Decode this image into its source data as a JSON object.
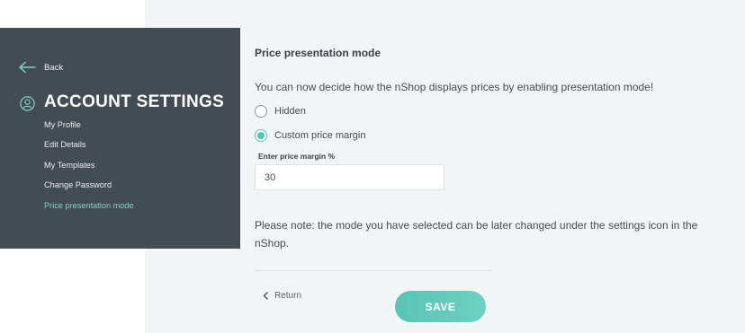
{
  "sidebar": {
    "back_label": "Back",
    "title": "ACCOUNT SETTINGS",
    "items": [
      {
        "label": "My Profile",
        "active": false
      },
      {
        "label": "Edit Details",
        "active": false
      },
      {
        "label": "My Templates",
        "active": false
      },
      {
        "label": "Change Password",
        "active": false
      },
      {
        "label": "Price presentation mode",
        "active": true
      }
    ]
  },
  "main": {
    "section_title": "Price presentation mode",
    "intro": "You can now decide how the nShop displays prices by enabling presentation mode!",
    "options": [
      {
        "label": "Hidden",
        "selected": false
      },
      {
        "label": "Custom price margin",
        "selected": true
      }
    ],
    "margin_field": {
      "label": "Enter price margin %",
      "value": "30"
    },
    "note": "Please note: the mode you have selected can be later changed under the settings icon in the nShop.",
    "return_label": "Return",
    "save_label": "SAVE"
  },
  "icons": {
    "back": "arrow-left-icon",
    "account": "user-icon",
    "return": "chevron-left-icon"
  },
  "colors": {
    "sidebar_bg": "#434c54",
    "accent": "#58c4b4",
    "active_menu": "#7fd3c7",
    "main_bg": "#f2f5f6"
  }
}
